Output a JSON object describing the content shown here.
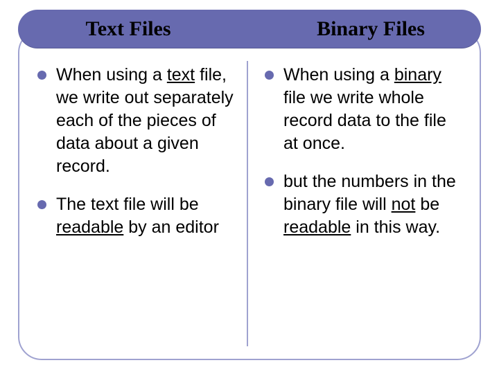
{
  "slide": {
    "title_left": "Text Files",
    "title_right": "Binary Files",
    "left_column": {
      "items": [
        {
          "pre": "When using a ",
          "u1": "text",
          "mid": " file, we write out separately each of the pieces of data about a given record.",
          "u2": "",
          "post": ""
        },
        {
          "pre": "The text file will be ",
          "u1": "readable",
          "mid": " by an editor",
          "u2": "",
          "post": ""
        }
      ]
    },
    "right_column": {
      "items": [
        {
          "pre": "When using a ",
          "u1": "binary",
          "mid": " file we write whole record data to the file at once.",
          "u2": "",
          "post": ""
        },
        {
          "pre": "but the numbers in the binary file will ",
          "u1": "not",
          "mid": " be ",
          "u2": "readable",
          "post": " in this way."
        }
      ]
    }
  },
  "colors": {
    "band": "#676aaf",
    "frame": "#9fa2d0"
  }
}
